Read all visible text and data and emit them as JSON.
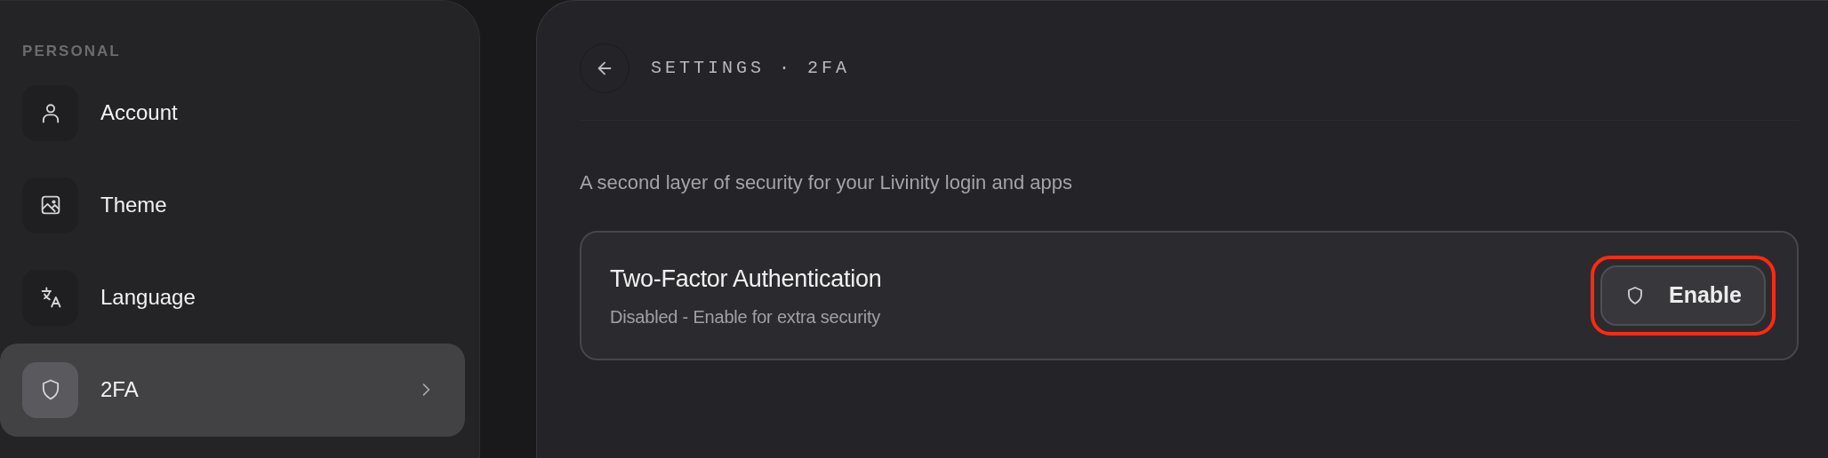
{
  "sidebar": {
    "section_label": "PERSONAL",
    "items": [
      {
        "label": "Account",
        "selected": false
      },
      {
        "label": "Theme",
        "selected": false
      },
      {
        "label": "Language",
        "selected": false
      },
      {
        "label": "2FA",
        "selected": true
      }
    ]
  },
  "header": {
    "breadcrumb": "SETTINGS · 2FA"
  },
  "description": "A second layer of security for your Livinity login and apps",
  "card": {
    "title": "Two-Factor Authentication",
    "subtitle": "Disabled - Enable for extra security",
    "button": {
      "label": "Enable",
      "highlighted": true
    }
  }
}
